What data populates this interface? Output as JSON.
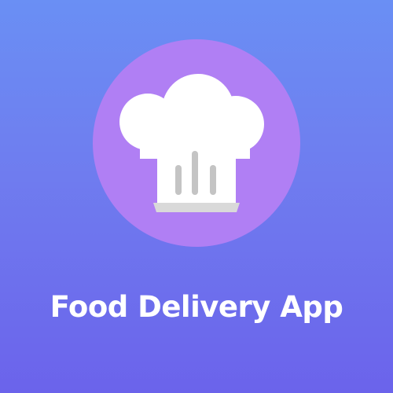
{
  "splash": {
    "app_name": "Food Delivery App",
    "logo_icon": "chef-hat-icon",
    "colors": {
      "background_top": "#6a8ff4",
      "background_bottom": "#6b63eb",
      "logo_circle": "#b07ff4",
      "hat": "#ffffff",
      "hat_stripes": "#c6c6c6",
      "hat_base": "#d6d6d6",
      "text": "#ffffff"
    }
  }
}
